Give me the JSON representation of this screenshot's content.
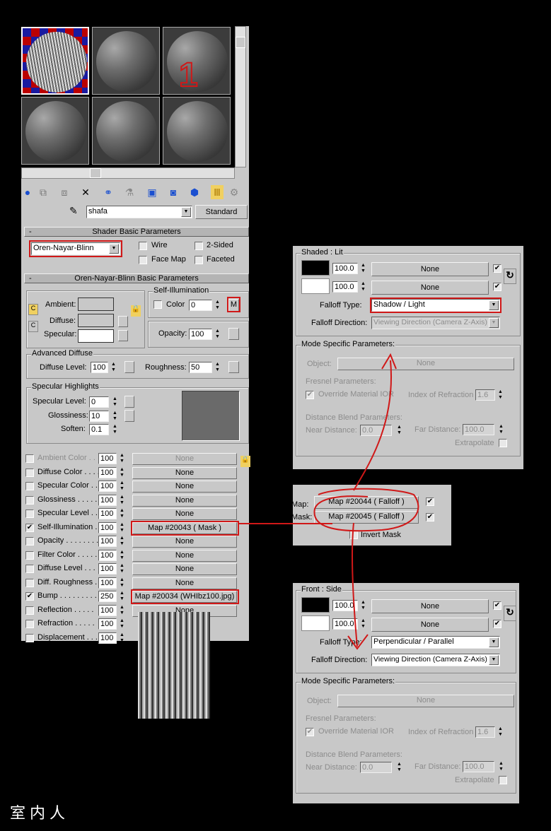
{
  "material_editor": {
    "material_name": "shafa",
    "material_type": "Standard",
    "slot_annotation": "1",
    "shader_rollout": {
      "title": "Shader Basic Parameters",
      "shader": "Oren-Nayar-Blinn",
      "wire": "Wire",
      "two_sided": "2-Sided",
      "face_map": "Face Map",
      "faceted": "Faceted"
    },
    "basic_rollout": {
      "title": "Oren-Nayar-Blinn Basic Parameters",
      "ambient": "Ambient:",
      "diffuse": "Diffuse:",
      "specular": "Specular:",
      "self_illum_group": "Self-Illumination",
      "color_label": "Color",
      "color_value": "0",
      "map_button": "M",
      "opacity_label": "Opacity:",
      "opacity_value": "100",
      "advanced_diffuse_group": "Advanced Diffuse",
      "diffuse_level_label": "Diffuse Level:",
      "diffuse_level_value": "100",
      "roughness_label": "Roughness:",
      "roughness_value": "50",
      "spec_group": "Specular Highlights",
      "spec_level_label": "Specular Level:",
      "spec_level_value": "0",
      "glossiness_label": "Glossiness:",
      "glossiness_value": "10",
      "soften_label": "Soften:",
      "soften_value": "0.1"
    },
    "maps": [
      {
        "name": "Ambient Color . . .",
        "amount": "100",
        "map": "None",
        "checked": false,
        "disabled": true
      },
      {
        "name": "Diffuse Color . . . .",
        "amount": "100",
        "map": "None",
        "checked": false
      },
      {
        "name": "Specular Color . .",
        "amount": "100",
        "map": "None",
        "checked": false
      },
      {
        "name": "Glossiness . . . . .",
        "amount": "100",
        "map": "None",
        "checked": false
      },
      {
        "name": "Specular Level . .",
        "amount": "100",
        "map": "None",
        "checked": false
      },
      {
        "name": "Self-Illumination .",
        "amount": "100",
        "map": "Map #20043  ( Mask )",
        "checked": true,
        "highlight": true
      },
      {
        "name": "Opacity . . . . . . . .",
        "amount": "100",
        "map": "None",
        "checked": false
      },
      {
        "name": "Filter Color . . . . .",
        "amount": "100",
        "map": "None",
        "checked": false
      },
      {
        "name": "Diffuse Level . . .",
        "amount": "100",
        "map": "None",
        "checked": false
      },
      {
        "name": "Diff. Roughness .",
        "amount": "100",
        "map": "None",
        "checked": false
      },
      {
        "name": "Bump . . . . . . . . .",
        "amount": "250",
        "map": "Map #20034 (WHIbz100.jpg)",
        "checked": true,
        "highlight": true
      },
      {
        "name": "Reflection . . . . .",
        "amount": "100",
        "map": "None",
        "checked": false
      },
      {
        "name": "Refraction . . . . .",
        "amount": "100",
        "map": "",
        "checked": false
      },
      {
        "name": "Displacement . . .",
        "amount": "100",
        "map": "",
        "checked": false
      }
    ]
  },
  "falloff_top": {
    "group": "Shaded : Lit",
    "amount1": "100.0",
    "map1": "None",
    "amount2": "100.0",
    "map2": "None",
    "type_label": "Falloff Type:",
    "type_value": "Shadow / Light",
    "dir_label": "Falloff Direction:",
    "dir_value": "Viewing Direction (Camera Z-Axis)",
    "mode_group": "Mode Specific Parameters:",
    "object_label": "Object:",
    "object_value": "None",
    "fresnel_label": "Fresnel Parameters:",
    "override_label": "Override Material IOR",
    "ior_label": "Index of Refraction",
    "ior_value": "1.6",
    "distance_label": "Distance Blend Parameters:",
    "near_label": "Near Distance:",
    "near_value": "0.0",
    "far_label": "Far Distance:",
    "far_value": "100.0",
    "extrapolate_label": "Extrapolate"
  },
  "mask_panel": {
    "map_label": "Map:",
    "map_value": "Map #20044  ( Falloff )",
    "mask_label": "Mask:",
    "mask_value": "Map #20045  ( Falloff )",
    "invert_label": "Invert Mask"
  },
  "falloff_bottom": {
    "group": "Front : Side",
    "amount1": "100.0",
    "map1": "None",
    "amount2": "100.0",
    "map2": "None",
    "type_label": "Falloff Type:",
    "type_value": "Perpendicular / Parallel",
    "dir_label": "Falloff Direction:",
    "dir_value": "Viewing Direction (Camera Z-Axis)",
    "mode_group": "Mode Specific Parameters:",
    "object_label": "Object:",
    "object_value": "None",
    "fresnel_label": "Fresnel Parameters:",
    "override_label": "Override Material IOR",
    "ior_label": "Index of Refraction",
    "ior_value": "1.6",
    "distance_label": "Distance Blend Parameters:",
    "near_label": "Near Distance:",
    "near_value": "0.0",
    "far_label": "Far Distance:",
    "far_value": "100.0",
    "extrapolate_label": "Extrapolate"
  },
  "watermark": "室内人",
  "colors": {
    "annotation": "#d01818",
    "panel": "#c8c8c8",
    "background": "#000000"
  }
}
